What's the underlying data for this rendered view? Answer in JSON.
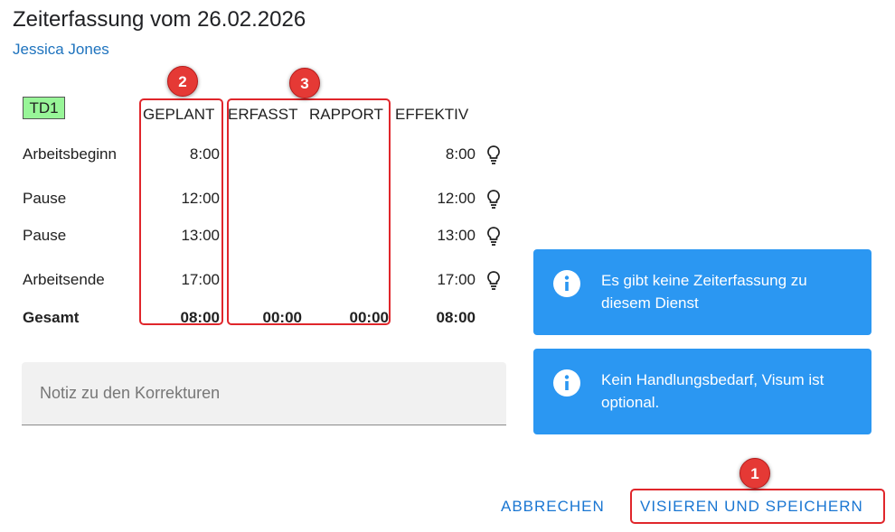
{
  "header": {
    "title": "Zeiterfassung vom 26.02.2026",
    "employee": "Jessica Jones"
  },
  "shift_tag": "TD1",
  "columns": {
    "planned": "GEPLANT",
    "recorded": "ERFASST",
    "report": "RAPPORT",
    "effective": "EFFEKTIV"
  },
  "rows": [
    {
      "label": "Arbeitsbeginn",
      "planned": "8:00",
      "effective": "8:00",
      "icon": "lightbulb-icon"
    },
    {
      "label": "Pause",
      "planned": "12:00",
      "effective": "12:00",
      "icon": "lightbulb-icon"
    },
    {
      "label": "Pause",
      "planned": "13:00",
      "effective": "13:00",
      "icon": "lightbulb-icon"
    },
    {
      "label": "Arbeitsende",
      "planned": "17:00",
      "effective": "17:00",
      "icon": "lightbulb-icon"
    }
  ],
  "total": {
    "label": "Gesamt",
    "planned": "08:00",
    "recorded": "00:00",
    "report": "00:00",
    "effective": "08:00"
  },
  "note": {
    "placeholder": "Notiz zu den Korrekturen",
    "value": ""
  },
  "info_messages": [
    {
      "line1": "Es gibt keine Zeiterfassung zu",
      "line2": "diesem Dienst",
      "icon": "info-icon"
    },
    {
      "line1": "Kein Handlungsbedarf, Visum ist",
      "line2": "optional.",
      "icon": "info-icon"
    }
  ],
  "actions": {
    "cancel": "ABBRECHEN",
    "save": "VISIEREN UND SPEICHERN"
  },
  "annotations": [
    "1",
    "2",
    "3"
  ],
  "colors": {
    "accent": "#1976d2",
    "info_bg": "#2b97f2",
    "annotation_red": "#e53935",
    "tag_bg": "#98f598"
  }
}
